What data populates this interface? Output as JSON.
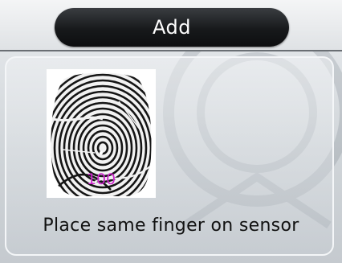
{
  "header": {
    "title": "Add"
  },
  "scan": {
    "quality_value": "100",
    "prompt": "Place same finger on sensor"
  },
  "colors": {
    "title_bar_bg": "#111315",
    "quality_text": "#cc22cc",
    "prompt_text": "#111111"
  },
  "icons": {
    "fingerprint": "fingerprint-icon"
  }
}
